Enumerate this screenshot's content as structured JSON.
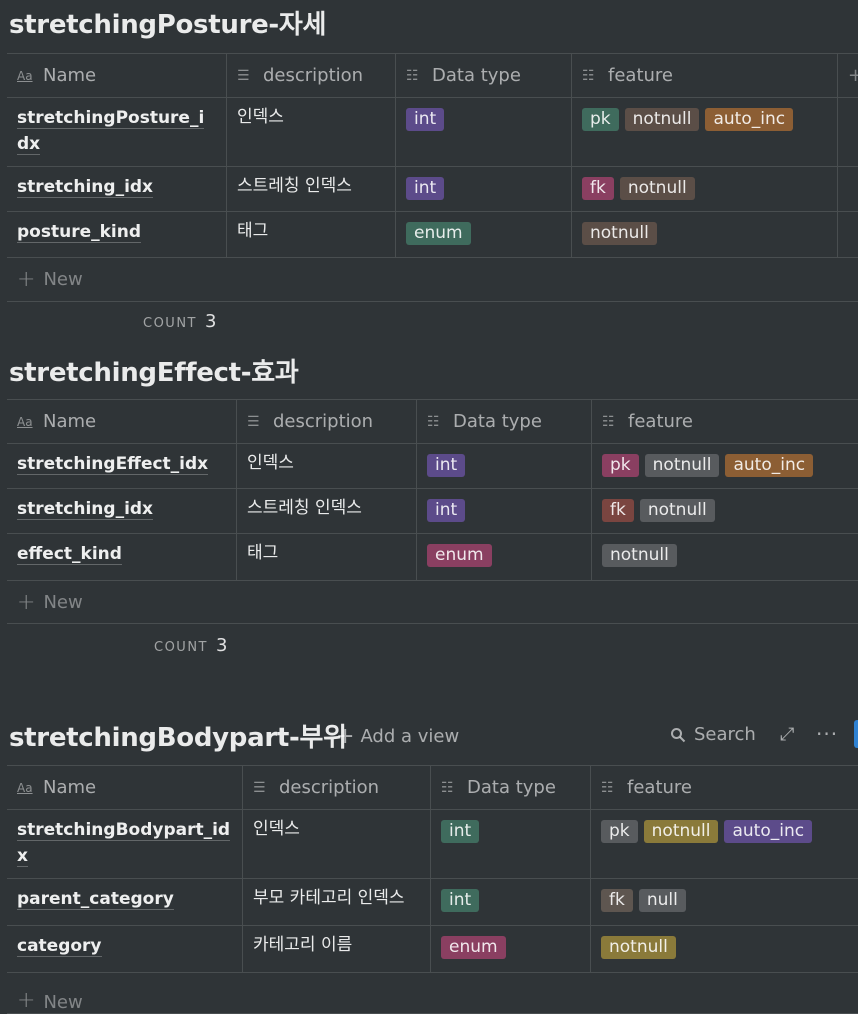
{
  "colors": {
    "background": "#2f3437",
    "purple": "#5c4b8a",
    "green": "#3f6b5d",
    "brown": "#5b4e47",
    "orange": "#8c5e34",
    "pink": "#8a3f61",
    "gray": "#585b5e",
    "yellow": "#8a7a3a",
    "red": "#7a4540",
    "graybrown": "#5e5650"
  },
  "new_label": "New",
  "count_label": "COUNT",
  "tables": [
    {
      "title": "stretchingPosture-자세",
      "headers": {
        "name": "Name",
        "description": "description",
        "datatype": "Data type",
        "feature": "feature"
      },
      "rows": [
        {
          "name": "stretchingPosture_idx",
          "description": "인덱스",
          "datatype": "int",
          "features": [
            "pk",
            "notnull",
            "auto_inc"
          ]
        },
        {
          "name": "stretching_idx",
          "description": "스트레칭 인덱스",
          "datatype": "int",
          "features": [
            "fk",
            "notnull"
          ]
        },
        {
          "name": "posture_kind",
          "description": "태그",
          "datatype": "enum",
          "features": [
            "notnull"
          ]
        }
      ],
      "count": "3"
    },
    {
      "title": "stretchingEffect-효과",
      "headers": {
        "name": "Name",
        "description": "description",
        "datatype": "Data type",
        "feature": "feature"
      },
      "rows": [
        {
          "name": "stretchingEffect_idx",
          "description": "인덱스",
          "datatype": "int",
          "features": [
            "pk",
            "notnull",
            "auto_inc"
          ]
        },
        {
          "name": "stretching_idx",
          "description": "스트레칭 인덱스",
          "datatype": "int",
          "features": [
            "fk",
            "notnull"
          ]
        },
        {
          "name": "effect_kind",
          "description": "태그",
          "datatype": "enum",
          "features": [
            "notnull"
          ]
        }
      ],
      "count": "3"
    },
    {
      "title": "stretchingBodypart-부위",
      "add_view": "Add a view",
      "search": "Search",
      "headers": {
        "name": "Name",
        "description": "description",
        "datatype": "Data type",
        "feature": "feature"
      },
      "rows": [
        {
          "name": "stretchingBodypart_idx",
          "description": "인덱스",
          "datatype": "int",
          "features": [
            "pk",
            "notnull",
            "auto_inc"
          ]
        },
        {
          "name": "parent_category",
          "description": "부모 카테고리 인덱스",
          "datatype": "int",
          "features": [
            "fk",
            "null"
          ]
        },
        {
          "name": "category",
          "description": "카테고리 이름",
          "datatype": "enum",
          "features": [
            "notnull"
          ]
        }
      ]
    }
  ]
}
